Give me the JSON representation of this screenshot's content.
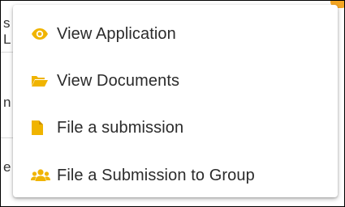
{
  "background_page": {
    "fragments": [
      "s",
      "L",
      "n",
      "e"
    ]
  },
  "colors": {
    "icon_accent": "#f0b400",
    "badge": "#f5a623",
    "text": "#2b2b2b"
  },
  "menu": {
    "items": [
      {
        "label": "View Application",
        "icon": "eye-icon"
      },
      {
        "label": "View Documents",
        "icon": "folder-open-icon"
      },
      {
        "label": "File a submission",
        "icon": "file-icon"
      },
      {
        "label": "File a Submission to Group",
        "icon": "users-icon"
      }
    ]
  }
}
